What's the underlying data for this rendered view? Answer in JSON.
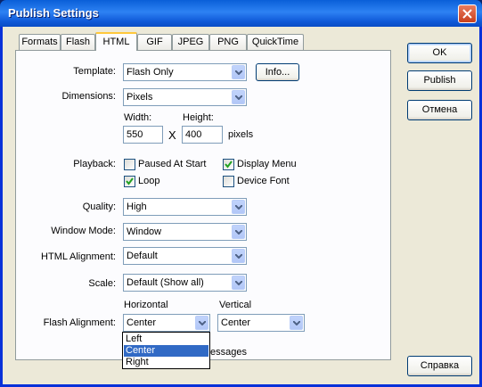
{
  "window": {
    "title": "Publish Settings"
  },
  "tabs": [
    {
      "label": "Formats"
    },
    {
      "label": "Flash"
    },
    {
      "label": "HTML",
      "active": true
    },
    {
      "label": "GIF"
    },
    {
      "label": "JPEG"
    },
    {
      "label": "PNG"
    },
    {
      "label": "QuickTime"
    }
  ],
  "form": {
    "template": {
      "label": "Template:",
      "value": "Flash Only",
      "info_button": "Info..."
    },
    "dimensions": {
      "label": "Dimensions:",
      "value": "Pixels",
      "width_label": "Width:",
      "width_value": "550",
      "height_label": "Height:",
      "height_value": "400",
      "times": "X",
      "units": "pixels"
    },
    "playback": {
      "label": "Playback:",
      "paused_at_start": {
        "label": "Paused At Start",
        "checked": false
      },
      "display_menu": {
        "label": "Display Menu",
        "checked": true
      },
      "loop": {
        "label": "Loop",
        "checked": true
      },
      "device_font": {
        "label": "Device Font",
        "checked": false
      }
    },
    "quality": {
      "label": "Quality:",
      "value": "High"
    },
    "window_mode": {
      "label": "Window Mode:",
      "value": "Window"
    },
    "html_alignment": {
      "label": "HTML Alignment:",
      "value": "Default"
    },
    "scale": {
      "label": "Scale:",
      "value": "Default (Show all)"
    },
    "flash_alignment": {
      "label": "Flash Alignment:",
      "horizontal_label": "Horizontal",
      "horizontal_value": "Center",
      "vertical_label": "Vertical",
      "vertical_value": "Center",
      "horizontal_options": [
        "Left",
        "Center",
        "Right"
      ],
      "highlighted_option": "Center"
    },
    "warning_partial": "essages"
  },
  "buttons": {
    "ok": "OK",
    "publish": "Publish",
    "cancel": "Отмена",
    "help": "Справка"
  },
  "colors": {
    "title_bar": "#0A5FD8",
    "client_bg": "#ECE9D8",
    "selection": "#316AC5",
    "active_tab_accent": "#FFC83C"
  }
}
